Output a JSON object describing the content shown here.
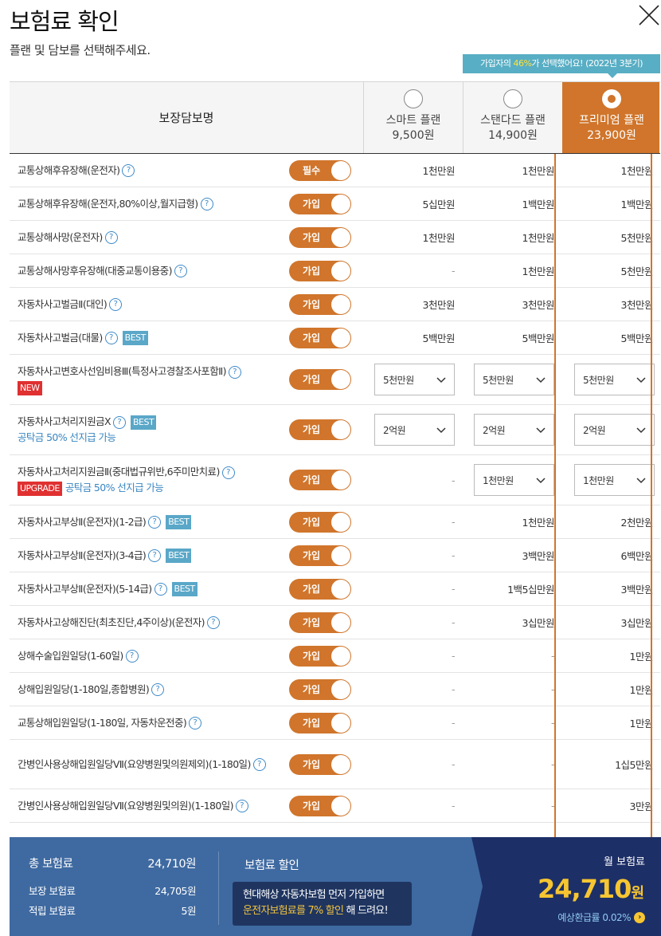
{
  "header": {
    "title": "보험료 확인",
    "subtitle": "플랜 및 담보를 선택해주세요.",
    "close_icon": "close-icon"
  },
  "popular": {
    "prefix": "가입자의 ",
    "percent": "46%",
    "suffix": "가 선택했어요!",
    "period": "(2022년 3분기)"
  },
  "table": {
    "name_header": "보장담보명",
    "plans": [
      {
        "name": "스마트 플랜",
        "price": "9,500원",
        "selected": false
      },
      {
        "name": "스탠다드 플랜",
        "price": "14,900원",
        "selected": false
      },
      {
        "name": "프리미엄 플랜",
        "price": "23,900원",
        "selected": true
      }
    ],
    "rows": [
      {
        "name": "교통상해후유장해(운전자)",
        "toggle": "필수",
        "v": [
          "1천만원",
          "1천만원",
          "1천만원"
        ]
      },
      {
        "name": "교통상해후유장해(운전자,80%이상,월지급형)",
        "toggle": "가입",
        "v": [
          "5십만원",
          "1백만원",
          "1백만원"
        ]
      },
      {
        "name": "교통상해사망(운전자)",
        "toggle": "가입",
        "v": [
          "1천만원",
          "1천만원",
          "5천만원"
        ]
      },
      {
        "name": "교통상해사망후유장해(대중교통이용중)",
        "toggle": "가입",
        "v": [
          "-",
          "1천만원",
          "5천만원"
        ]
      },
      {
        "name": "자동차사고벌금Ⅱ(대인)",
        "toggle": "가입",
        "v": [
          "3천만원",
          "3천만원",
          "3천만원"
        ]
      },
      {
        "name": "자동차사고벌금(대물)",
        "toggle": "가입",
        "best": "BEST",
        "v": [
          "5백만원",
          "5백만원",
          "5백만원"
        ]
      },
      {
        "name": "자동차사고변호사선임비용Ⅲ(특정사고경찰조사포함Ⅱ)",
        "toggle": "가입",
        "new": "NEW",
        "dd": [
          "5천만원",
          "5천만원",
          "5천만원"
        ]
      },
      {
        "name": "자동차사고처리지원금Ⅹ",
        "toggle": "가입",
        "best": "BEST",
        "note": "공탁금 50% 선지급 가능",
        "dd": [
          "2억원",
          "2억원",
          "2억원"
        ]
      },
      {
        "name": "자동차사고처리지원금Ⅱ(중대법규위반,6주미만치료)",
        "toggle": "가입",
        "upgrade": "UPGRADE",
        "note": "공탁금 50% 선지급 가능",
        "v0": "-",
        "dd2": [
          "1천만원",
          "1천만원"
        ]
      },
      {
        "name": "자동차사고부상Ⅱ(운전자)(1-2급)",
        "toggle": "가입",
        "best": "BEST",
        "v": [
          "-",
          "1천만원",
          "2천만원"
        ]
      },
      {
        "name": "자동차사고부상Ⅱ(운전자)(3-4급)",
        "toggle": "가입",
        "best": "BEST",
        "v": [
          "-",
          "3백만원",
          "6백만원"
        ]
      },
      {
        "name": "자동차사고부상Ⅱ(운전자)(5-14급)",
        "toggle": "가입",
        "best": "BEST",
        "v": [
          "-",
          "1백5십만원",
          "3백만원"
        ]
      },
      {
        "name": "자동차사고상해진단(최초진단,4주이상)(운전자)",
        "toggle": "가입",
        "v": [
          "-",
          "3십만원",
          "3십만원"
        ]
      },
      {
        "name": "상해수술입원일당(1-60일)",
        "toggle": "가입",
        "v": [
          "-",
          "-",
          "1만원"
        ]
      },
      {
        "name": "상해입원일당(1-180일,종합병원)",
        "toggle": "가입",
        "v": [
          "-",
          "-",
          "1만원"
        ]
      },
      {
        "name": "교통상해입원일당(1-180일, 자동차운전중)",
        "toggle": "가입",
        "v": [
          "-",
          "-",
          "1만원"
        ]
      },
      {
        "name": "간병인사용상해입원일당Ⅶ(요양병원및의원제외)(1-180일)",
        "toggle": "가입",
        "v": [
          "-",
          "-",
          "1십5만원"
        ]
      },
      {
        "name": "간병인사용상해입원일당Ⅶ(요양병원및의원)(1-180일)",
        "toggle": "가입",
        "v": [
          "-",
          "-",
          "3만원"
        ]
      }
    ]
  },
  "footer": {
    "total_label": "총 보험료",
    "total_value": "24,710원",
    "coverage_label": "보장 보험료",
    "coverage_value": "24,705원",
    "savings_label": "적립 보험료",
    "savings_value": "5원",
    "discount_title": "보험료 할인",
    "promo_line1": "현대해상 자동차보험 먼저 가입하면",
    "promo_hl": "운전자보험료를 7% 할인",
    "promo_tail": " 해 드려요!",
    "monthly_label": "월 보험료",
    "monthly_value": "24,710",
    "monthly_unit": "원",
    "refund": "예상환급률 0.02%"
  },
  "colors": {
    "accent": "#d0752b",
    "badge": "#58aec4",
    "footer": "#3f6aa1",
    "footer_dark": "#1d2f67",
    "highlight": "#f6c531"
  }
}
